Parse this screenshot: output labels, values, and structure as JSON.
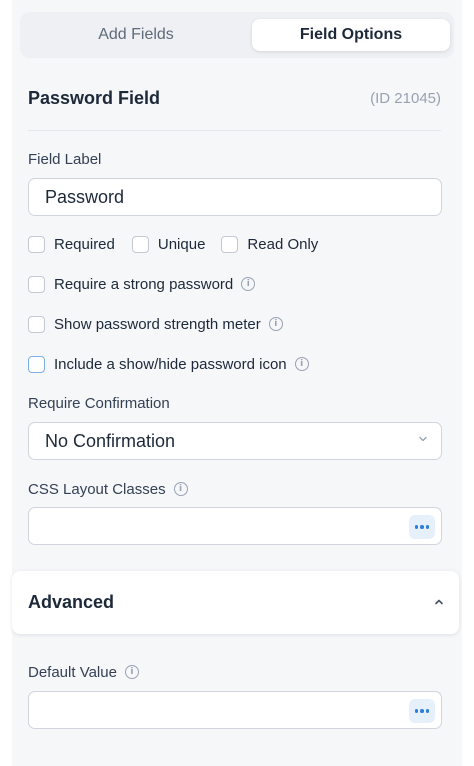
{
  "tabs": {
    "add_fields": "Add Fields",
    "field_options": "Field Options"
  },
  "field": {
    "title": "Password Field",
    "id_text": "(ID 21045)"
  },
  "field_label": {
    "label": "Field Label",
    "value": "Password"
  },
  "checkboxes": {
    "required": "Required",
    "unique": "Unique",
    "read_only": "Read Only",
    "strong_password": "Require a strong password",
    "strength_meter": "Show password strength meter",
    "show_hide_icon": "Include a show/hide password icon"
  },
  "confirmation": {
    "label": "Require Confirmation",
    "value": "No Confirmation"
  },
  "css_classes": {
    "label": "CSS Layout Classes",
    "value": ""
  },
  "advanced": {
    "title": "Advanced"
  },
  "default_value": {
    "label": "Default Value",
    "value": ""
  },
  "icons": {
    "info": "info-icon",
    "caret_down": "chevron-down-icon",
    "caret_up": "chevron-up-icon",
    "more": "more-dots-icon"
  },
  "colors": {
    "accent": "#2f7fd6",
    "panel_bg": "#f6f7f9"
  }
}
